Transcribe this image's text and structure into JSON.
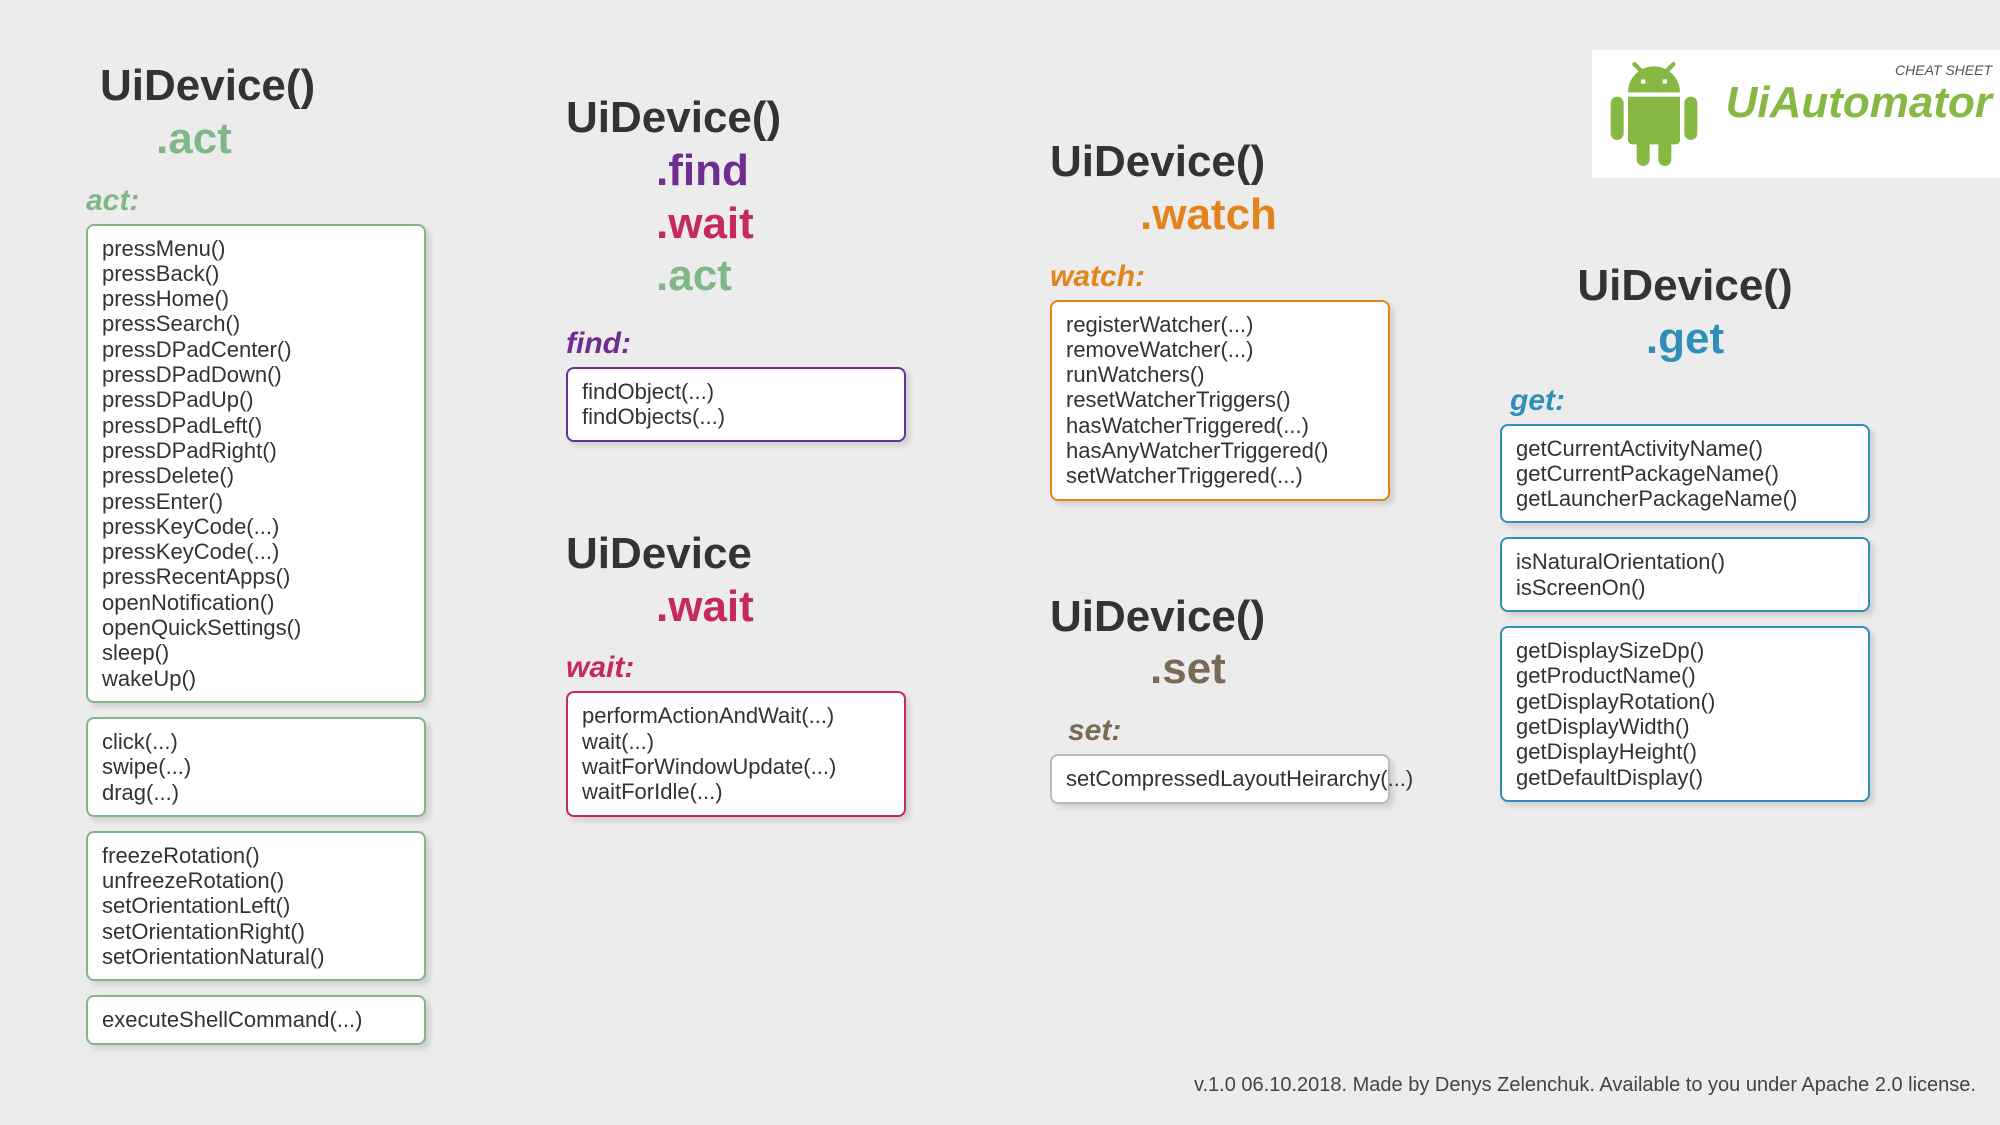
{
  "logo": {
    "tag": "CHEAT SHEET",
    "name": "UiAutomator"
  },
  "footer": "v.1.0 06.10.2018. Made by Denys Zelenchuk. Available to you under Apache 2.0 license.",
  "headings": {
    "uidevice": "UiDevice()",
    "uidevice_plain": "UiDevice"
  },
  "subs": {
    "act": ".act",
    "find": ".find",
    "wait": ".wait",
    "watch": ".watch",
    "set": ".set",
    "get": ".get"
  },
  "labels": {
    "act": "act:",
    "find": "find:",
    "wait": "wait:",
    "watch": "watch:",
    "set": "set:",
    "get": "get:"
  },
  "boxes": {
    "act1": [
      "pressMenu()",
      "pressBack()",
      "pressHome()",
      "pressSearch()",
      "pressDPadCenter()",
      "pressDPadDown()",
      "pressDPadUp()",
      "pressDPadLeft()",
      "pressDPadRight()",
      "pressDelete()",
      "pressEnter()",
      "pressKeyCode(...)",
      "pressKeyCode(...)",
      "pressRecentApps()",
      "openNotification()",
      "openQuickSettings()",
      "sleep()",
      "wakeUp()"
    ],
    "act2": [
      "click(...)",
      "swipe(...)",
      "drag(...)"
    ],
    "act3": [
      "freezeRotation()",
      "unfreezeRotation()",
      "setOrientationLeft()",
      "setOrientationRight()",
      "setOrientationNatural()"
    ],
    "act4": [
      "executeShellCommand(...)"
    ],
    "find": [
      "findObject(...)",
      "findObjects(...)"
    ],
    "wait": [
      "performActionAndWait(...)",
      "wait(...)",
      "waitForWindowUpdate(...)",
      "waitForIdle(...)"
    ],
    "watch": [
      "registerWatcher(...)",
      "removeWatcher(...)",
      "runWatchers()",
      "resetWatcherTriggers()",
      "hasWatcherTriggered(...)",
      "hasAnyWatcherTriggered()",
      "setWatcherTriggered(...)"
    ],
    "set": [
      "setCompressedLayoutHeirarchy(...)"
    ],
    "get1": [
      "getCurrentActivityName()",
      "getCurrentPackageName()",
      "getLauncherPackageName()"
    ],
    "get2": [
      "isNaturalOrientation()",
      "isScreenOn()"
    ],
    "get3": [
      "getDisplaySizeDp()",
      "getProductName()",
      "getDisplayRotation()",
      "getDisplayWidth()",
      "getDisplayHeight()",
      "getDefaultDisplay()"
    ]
  }
}
